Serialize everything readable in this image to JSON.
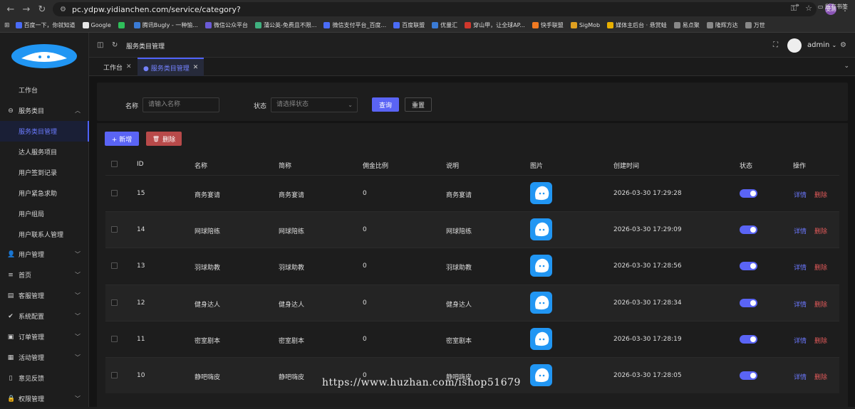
{
  "browser": {
    "url": "pc.ydpw.yidianchen.com/service/category?",
    "profile_initials": "受测",
    "bookmarks": [
      {
        "label": "百度一下，你就知道",
        "color": "#4a6cf7"
      },
      {
        "label": "Google",
        "color": "#e8e8e8"
      },
      {
        "label": "",
        "color": "#2fbf5a"
      },
      {
        "label": "腾讯Bugly - 一种愉...",
        "color": "#3a7bd5"
      },
      {
        "label": "微信公众平台",
        "color": "#6b5bd6"
      },
      {
        "label": "蒲公英-免费且不限...",
        "color": "#3fb07f"
      },
      {
        "label": "微信支付平台_百度...",
        "color": "#4a6cf7"
      },
      {
        "label": "百度联盟",
        "color": "#4a6cf7"
      },
      {
        "label": "优量汇",
        "color": "#3a7bd5"
      },
      {
        "label": "穿山甲，让全球AP...",
        "color": "#d0372c"
      },
      {
        "label": "快手联盟",
        "color": "#f07a22"
      },
      {
        "label": "SigMob",
        "color": "#e0a020"
      },
      {
        "label": "媒体主后台 · 悬赏蛙",
        "color": "#e8b000"
      },
      {
        "label": "易点聚",
        "color": "#888"
      },
      {
        "label": "隆辉方达",
        "color": "#888"
      },
      {
        "label": "万世",
        "color": "#888"
      }
    ],
    "bookmarks_more": "»",
    "all_bookmarks": "所有书签"
  },
  "sidebar": {
    "items": [
      {
        "label": "工作台",
        "icon": "none",
        "sub": false,
        "active": false,
        "chevron": false
      },
      {
        "label": "服务类目",
        "icon": "category-icon",
        "sub": false,
        "active": false,
        "chevron": "up"
      },
      {
        "label": "服务类目管理",
        "icon": "none",
        "sub": true,
        "active": true,
        "chevron": false
      },
      {
        "label": "达人服务项目",
        "icon": "none",
        "sub": true,
        "active": false,
        "chevron": false
      },
      {
        "label": "用户签到记录",
        "icon": "none",
        "sub": true,
        "active": false,
        "chevron": false
      },
      {
        "label": "用户紧急求助",
        "icon": "none",
        "sub": true,
        "active": false,
        "chevron": false
      },
      {
        "label": "用户组局",
        "icon": "none",
        "sub": true,
        "active": false,
        "chevron": false
      },
      {
        "label": "用户联系人管理",
        "icon": "none",
        "sub": true,
        "active": false,
        "chevron": false
      },
      {
        "label": "用户管理",
        "icon": "user-icon",
        "sub": false,
        "active": false,
        "chevron": "down"
      },
      {
        "label": "首页",
        "icon": "list-icon",
        "sub": false,
        "active": false,
        "chevron": "down"
      },
      {
        "label": "客服管理",
        "icon": "chat-icon",
        "sub": false,
        "active": false,
        "chevron": "down"
      },
      {
        "label": "系统配置",
        "icon": "check-circle-icon",
        "sub": false,
        "active": false,
        "chevron": "down"
      },
      {
        "label": "订单管理",
        "icon": "order-icon",
        "sub": false,
        "active": false,
        "chevron": "down"
      },
      {
        "label": "活动管理",
        "icon": "calendar-icon",
        "sub": false,
        "active": false,
        "chevron": "down"
      },
      {
        "label": "意见反馈",
        "icon": "feedback-icon",
        "sub": false,
        "active": false,
        "chevron": false
      },
      {
        "label": "权限管理",
        "icon": "lock-icon",
        "sub": false,
        "active": false,
        "chevron": "down"
      }
    ]
  },
  "header": {
    "title": "服务类目管理",
    "user": "admin"
  },
  "tabs": [
    {
      "label": "工作台",
      "active": false
    },
    {
      "label": "● 服务类目管理",
      "active": true
    }
  ],
  "search": {
    "name_label": "名称",
    "name_placeholder": "请输入名称",
    "status_label": "状态",
    "status_placeholder": "请选择状态",
    "query_button": "查询",
    "reset_button": "重置"
  },
  "toolbar": {
    "add_button": "+ 新增",
    "delete_button": "删除"
  },
  "table": {
    "columns": [
      "ID",
      "名称",
      "简称",
      "佣金比例",
      "说明",
      "图片",
      "创建时间",
      "状态",
      "操作"
    ],
    "rows": [
      {
        "id": "15",
        "name": "商务宴请",
        "short": "商务宴请",
        "rate": "0",
        "desc": "商务宴请",
        "created": "2026-03-30 17:29:28",
        "status": true
      },
      {
        "id": "14",
        "name": "网球陪练",
        "short": "网球陪练",
        "rate": "0",
        "desc": "网球陪练",
        "created": "2026-03-30 17:29:09",
        "status": true
      },
      {
        "id": "13",
        "name": "羽球助教",
        "short": "羽球助教",
        "rate": "0",
        "desc": "羽球助教",
        "created": "2026-03-30 17:28:56",
        "status": true
      },
      {
        "id": "12",
        "name": "健身达人",
        "short": "健身达人",
        "rate": "0",
        "desc": "健身达人",
        "created": "2026-03-30 17:28:34",
        "status": true
      },
      {
        "id": "11",
        "name": "密室剧本",
        "short": "密室剧本",
        "rate": "0",
        "desc": "密室剧本",
        "created": "2026-03-30 17:28:19",
        "status": true
      },
      {
        "id": "10",
        "name": "静吧嗨皮",
        "short": "静吧嗨皮",
        "rate": "0",
        "desc": "静吧嗨皮",
        "created": "2026-03-30 17:28:05",
        "status": true
      }
    ],
    "detail_label": "详情",
    "delete_label": "删除"
  },
  "watermark": "https://www.huzhan.com/ishop51679"
}
